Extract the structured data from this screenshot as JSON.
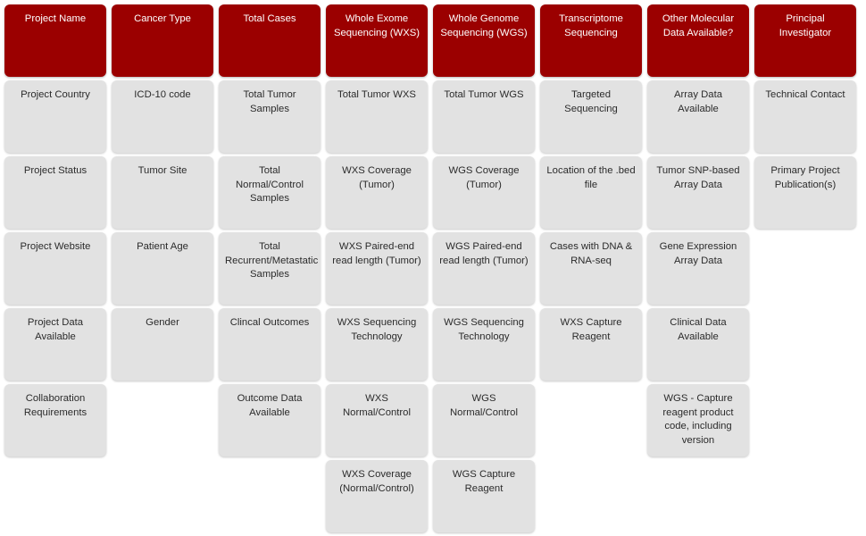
{
  "palette": {
    "header_bg": "#9B0000",
    "header_text": "#FFFFFF",
    "cell_bg": "#E2E2E2",
    "cell_text": "#2B2B2B",
    "page_bg": "#FFFFFF"
  },
  "grid": {
    "columns": 8,
    "rows": 7,
    "columns_data": [
      {
        "header": "Project Name",
        "cells": [
          "Project Country",
          "Project Status",
          "Project Website",
          "Project Data Available",
          "Collaboration Requirements",
          ""
        ]
      },
      {
        "header": "Cancer Type",
        "cells": [
          "ICD-10 code",
          "Tumor Site",
          "Patient Age",
          "Gender",
          "",
          ""
        ]
      },
      {
        "header": "Total Cases",
        "cells": [
          "Total Tumor Samples",
          "Total Normal/Control Samples",
          "Total Recurrent/Metastatic Samples",
          "Clincal Outcomes",
          "Outcome Data Available",
          ""
        ]
      },
      {
        "header": "Whole Exome Sequencing (WXS)",
        "cells": [
          "Total Tumor WXS",
          "WXS Coverage (Tumor)",
          "WXS Paired-end read length (Tumor)",
          "WXS Sequencing Technology",
          "WXS Normal/Control",
          "WXS Coverage (Normal/Control)"
        ]
      },
      {
        "header": "Whole Genome Sequencing (WGS)",
        "cells": [
          "Total Tumor WGS",
          "WGS Coverage (Tumor)",
          "WGS Paired-end read length (Tumor)",
          "WGS Sequencing Technology",
          "WGS Normal/Control",
          "WGS Capture Reagent"
        ]
      },
      {
        "header": "Transcriptome Sequencing",
        "cells": [
          "Targeted Sequencing",
          "Location of the .bed file",
          "Cases with DNA & RNA-seq",
          "WXS Capture Reagent",
          "",
          ""
        ]
      },
      {
        "header": "Other Molecular Data Available?",
        "cells": [
          "Array Data Available",
          "Tumor SNP-based Array Data",
          "Gene Expression Array Data",
          "Clinical Data Available",
          "WGS - Capture reagent product code, including version",
          ""
        ]
      },
      {
        "header": "Principal Investigator",
        "cells": [
          "Technical Contact",
          "Primary Project Publication(s)",
          "",
          "",
          "",
          ""
        ]
      }
    ]
  }
}
